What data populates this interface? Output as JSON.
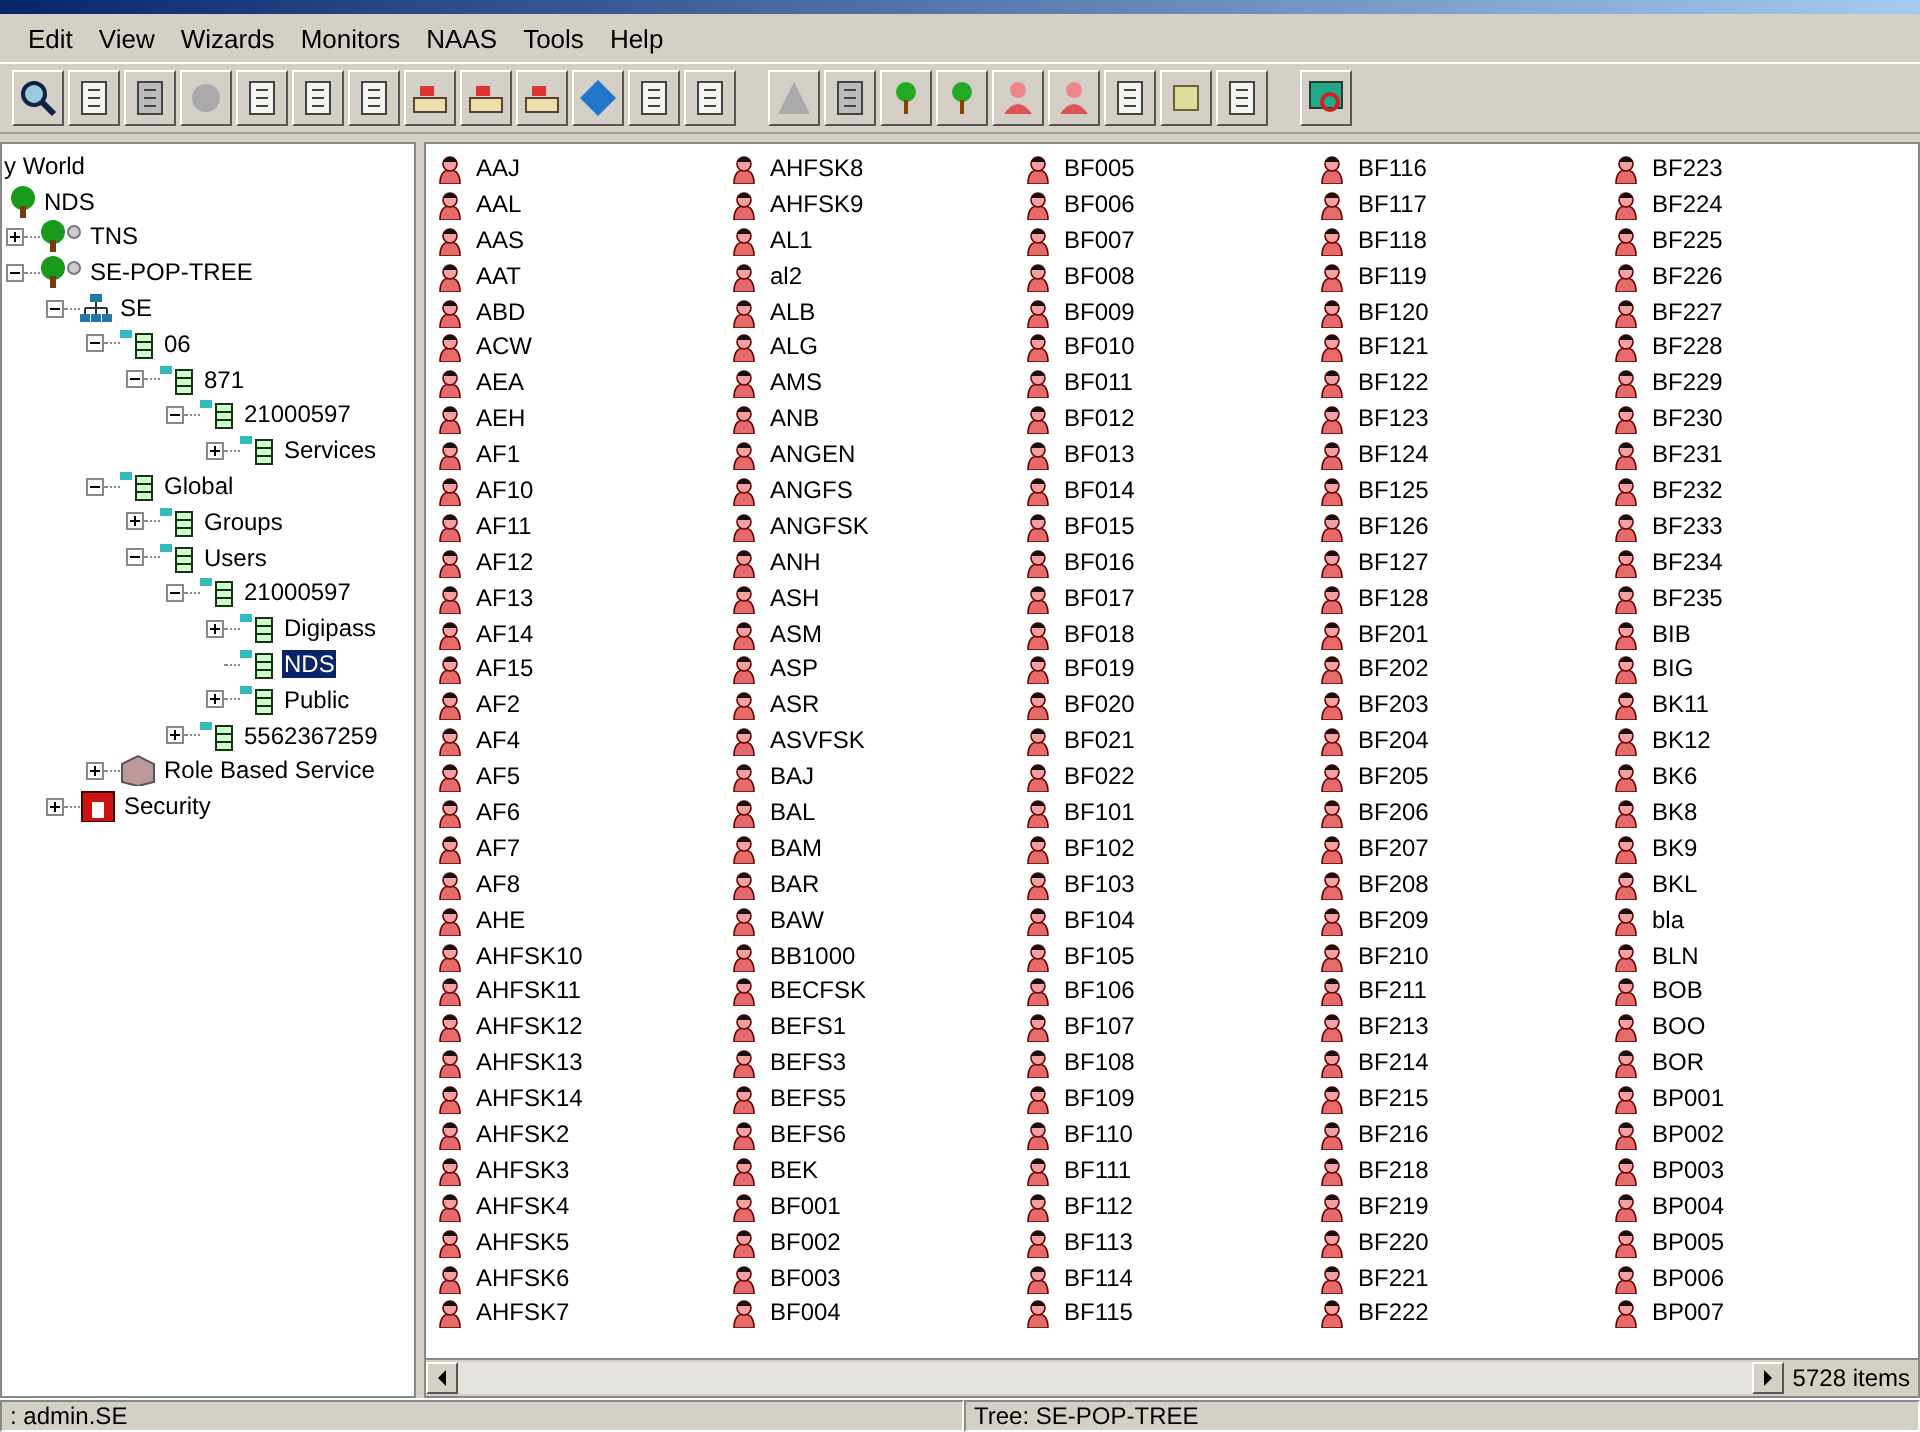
{
  "menu": [
    "Edit",
    "View",
    "Wizards",
    "Monitors",
    "NAAS",
    "Tools",
    "Help"
  ],
  "tree": [
    {
      "label": "y World",
      "children": [
        {
          "label": "NDS",
          "kind": "tree",
          "children": [
            {
              "label": "TNS",
              "kind": "tree",
              "expanded": false
            },
            {
              "label": "SE-POP-TREE",
              "kind": "tree",
              "expanded": true,
              "children": [
                {
                  "label": "SE",
                  "kind": "org",
                  "expanded": true,
                  "children": [
                    {
                      "label": "06",
                      "kind": "container",
                      "expanded": true,
                      "children": [
                        {
                          "label": "871",
                          "kind": "container",
                          "expanded": true,
                          "children": [
                            {
                              "label": "21000597",
                              "kind": "container",
                              "expanded": true,
                              "children": [
                                {
                                  "label": "Services",
                                  "kind": "container",
                                  "expanded": false
                                }
                              ]
                            }
                          ]
                        }
                      ]
                    },
                    {
                      "label": "Global",
                      "kind": "container",
                      "expanded": true,
                      "children": [
                        {
                          "label": "Groups",
                          "kind": "container",
                          "expanded": false
                        },
                        {
                          "label": "Users",
                          "kind": "container",
                          "expanded": true,
                          "children": [
                            {
                              "label": "21000597",
                              "kind": "container",
                              "expanded": true,
                              "children": [
                                {
                                  "label": "Digipass",
                                  "kind": "container",
                                  "expanded": false
                                },
                                {
                                  "label": "NDS",
                                  "kind": "container",
                                  "selected": true
                                },
                                {
                                  "label": "Public",
                                  "kind": "container",
                                  "expanded": false
                                }
                              ]
                            },
                            {
                              "label": "5562367259",
                              "kind": "container",
                              "expanded": false
                            }
                          ]
                        }
                      ]
                    },
                    {
                      "label": "Role Based Service",
                      "kind": "role",
                      "expanded": false
                    }
                  ]
                },
                {
                  "label": "Security",
                  "kind": "security",
                  "expanded": false
                }
              ]
            }
          ]
        }
      ]
    }
  ],
  "items": [
    "AAJ",
    "AAL",
    "AAS",
    "AAT",
    "ABD",
    "ACW",
    "AEA",
    "AEH",
    "AF1",
    "AF10",
    "AF11",
    "AF12",
    "AF13",
    "AF14",
    "AF15",
    "AF2",
    "AF4",
    "AF5",
    "AF6",
    "AF7",
    "AF8",
    "AHE",
    "AHFSK10",
    "AHFSK11",
    "AHFSK12",
    "AHFSK13",
    "AHFSK14",
    "AHFSK2",
    "AHFSK3",
    "AHFSK4",
    "AHFSK5",
    "AHFSK6",
    "AHFSK7",
    "AHFSK8",
    "AHFSK9",
    "AL1",
    "al2",
    "ALB",
    "ALG",
    "AMS",
    "ANB",
    "ANGEN",
    "ANGFS",
    "ANGFSK",
    "ANH",
    "ASH",
    "ASM",
    "ASP",
    "ASR",
    "ASVFSK",
    "BAJ",
    "BAL",
    "BAM",
    "BAR",
    "BAW",
    "BB1000",
    "BECFSK",
    "BEFS1",
    "BEFS3",
    "BEFS5",
    "BEFS6",
    "BEK",
    "BF001",
    "BF002",
    "BF003",
    "BF004",
    "BF005",
    "BF006",
    "BF007",
    "BF008",
    "BF009",
    "BF010",
    "BF011",
    "BF012",
    "BF013",
    "BF014",
    "BF015",
    "BF016",
    "BF017",
    "BF018",
    "BF019",
    "BF020",
    "BF021",
    "BF022",
    "BF101",
    "BF102",
    "BF103",
    "BF104",
    "BF105",
    "BF106",
    "BF107",
    "BF108",
    "BF109",
    "BF110",
    "BF111",
    "BF112",
    "BF113",
    "BF114",
    "BF115",
    "BF116",
    "BF117",
    "BF118",
    "BF119",
    "BF120",
    "BF121",
    "BF122",
    "BF123",
    "BF124",
    "BF125",
    "BF126",
    "BF127",
    "BF128",
    "BF201",
    "BF202",
    "BF203",
    "BF204",
    "BF205",
    "BF206",
    "BF207",
    "BF208",
    "BF209",
    "BF210",
    "BF211",
    "BF213",
    "BF214",
    "BF215",
    "BF216",
    "BF218",
    "BF219",
    "BF220",
    "BF221",
    "BF222",
    "BF223",
    "BF224",
    "BF225",
    "BF226",
    "BF227",
    "BF228",
    "BF229",
    "BF230",
    "BF231",
    "BF232",
    "BF233",
    "BF234",
    "BF235",
    "BIB",
    "BIG",
    "BK11",
    "BK12",
    "BK6",
    "BK8",
    "BK9",
    "BKL",
    "bla",
    "BLN",
    "BOB",
    "BOO",
    "BOR",
    "BP001",
    "BP002",
    "BP003",
    "BP004",
    "BP005",
    "BP006",
    "BP007"
  ],
  "item_count": "5728 items",
  "status_bar": [
    ": admin.SE",
    "Tree: SE-POP-TREE"
  ]
}
